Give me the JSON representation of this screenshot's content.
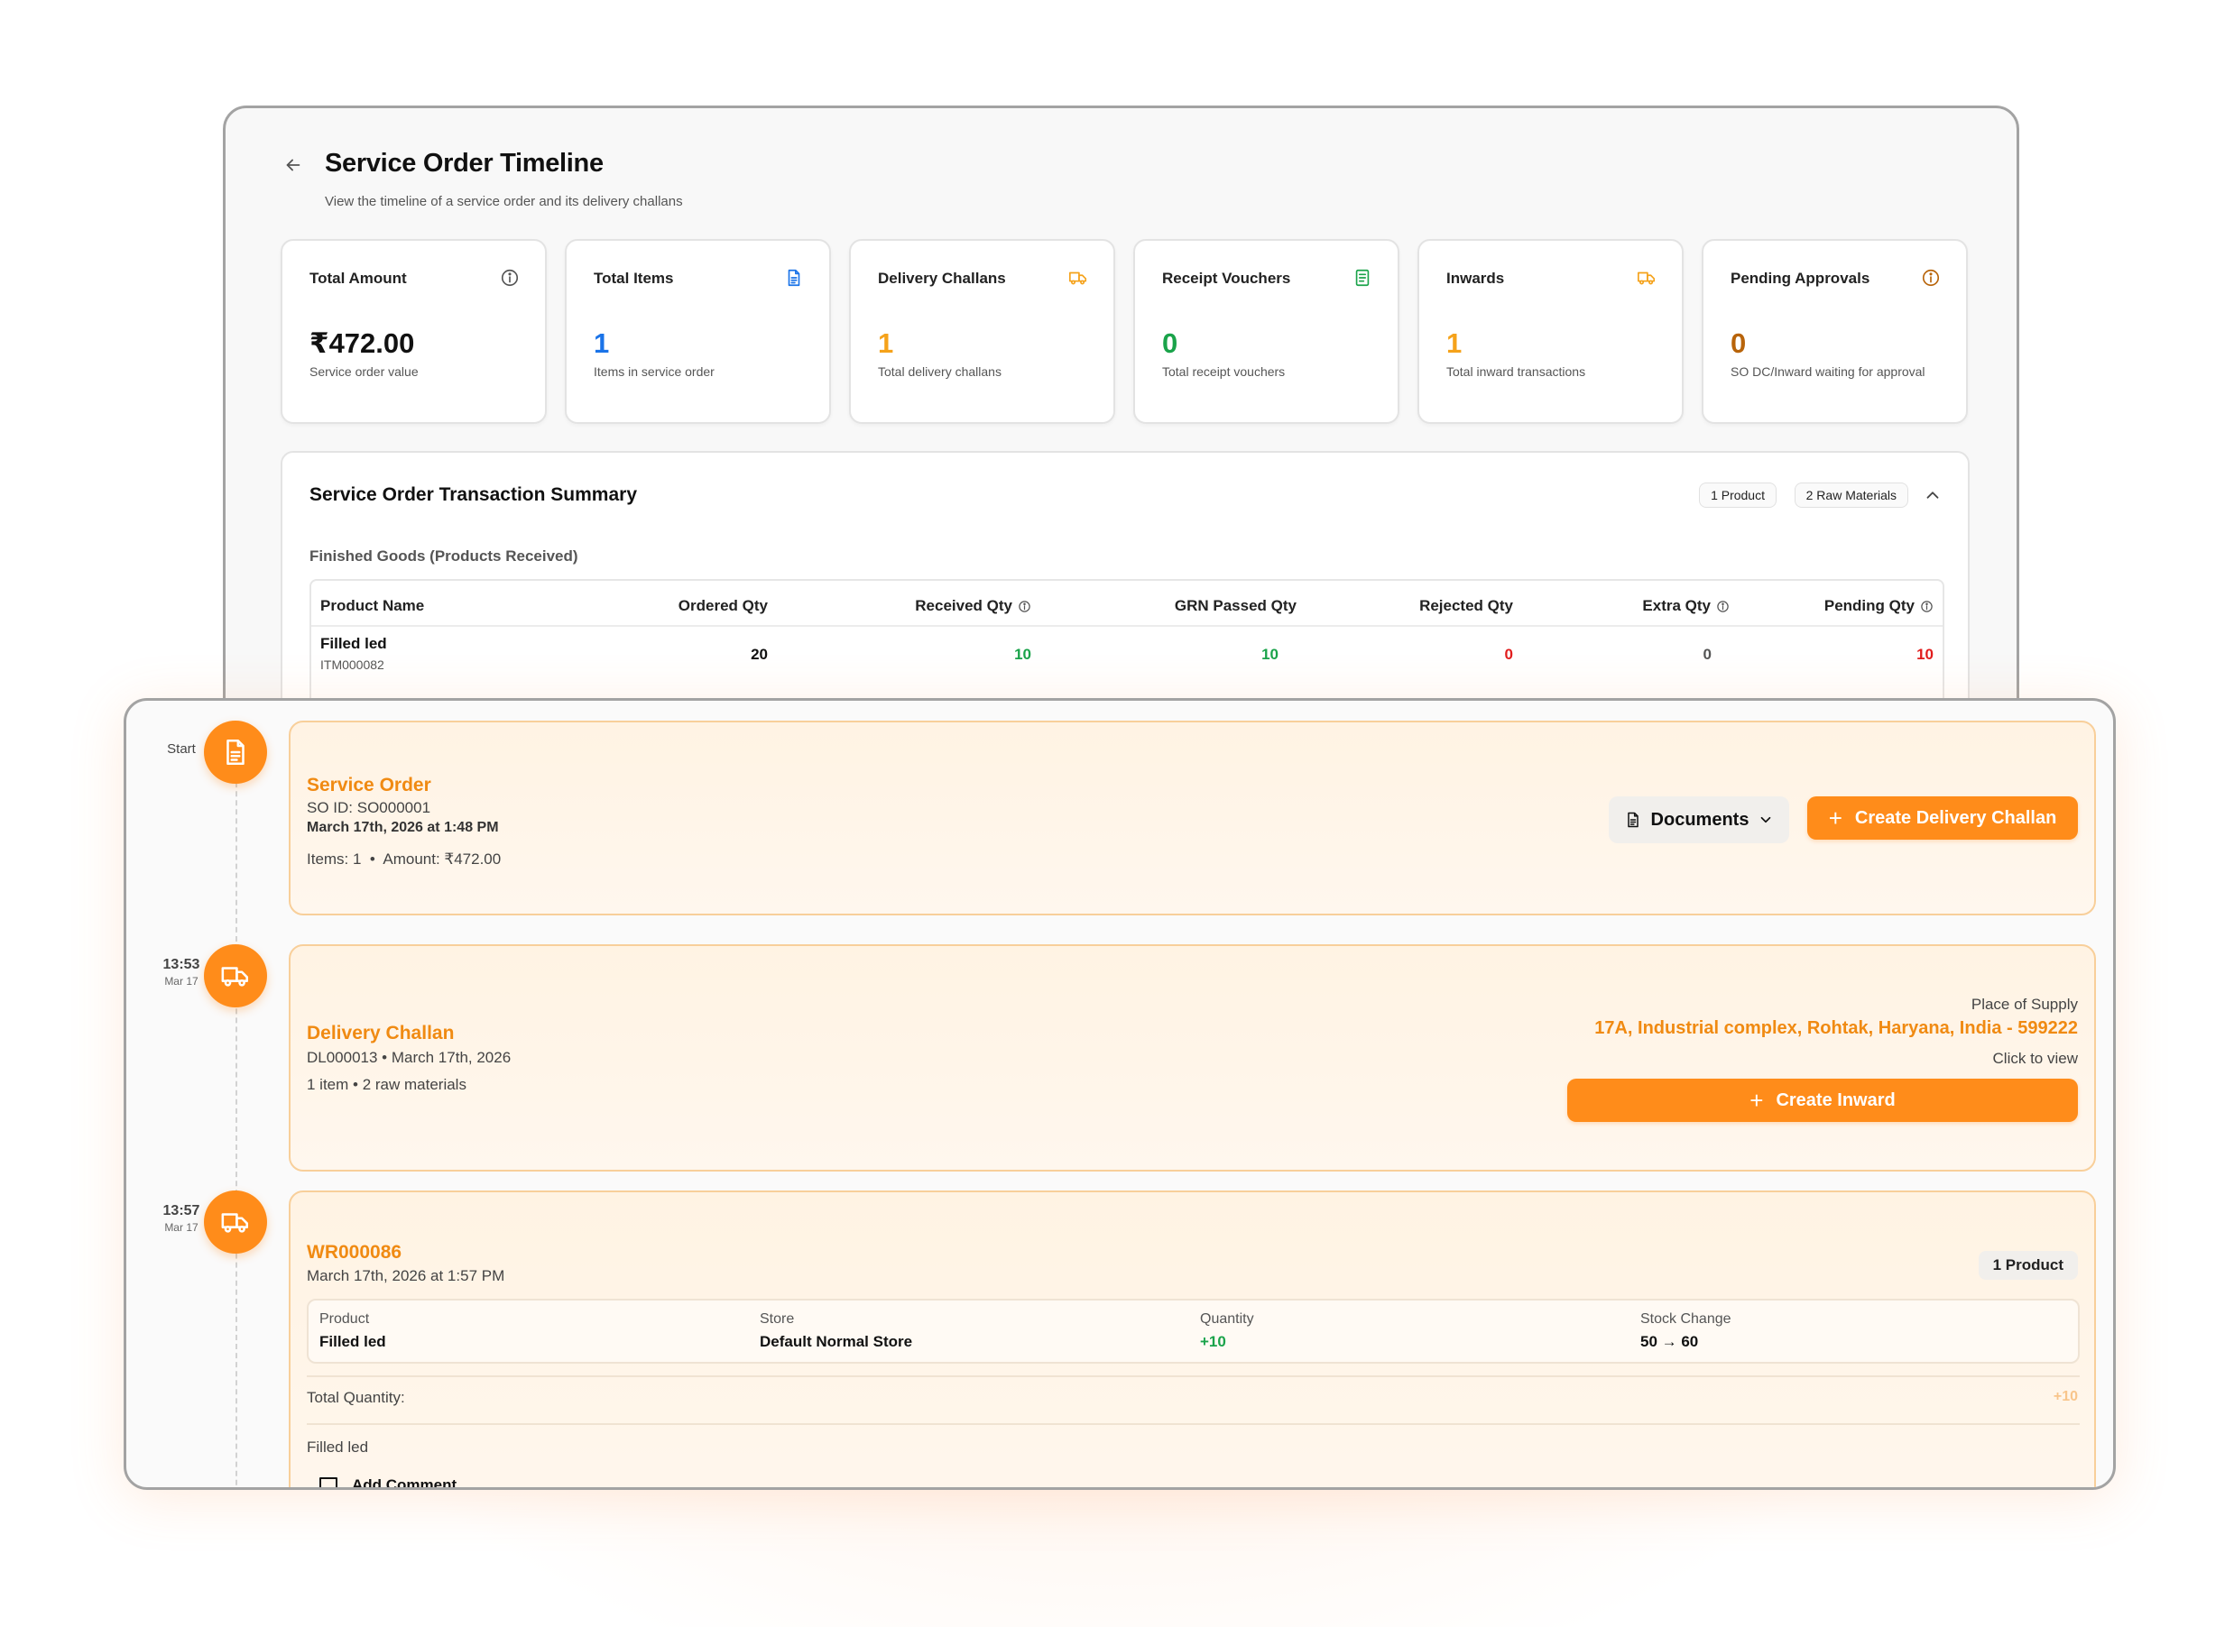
{
  "header": {
    "title": "Service Order Timeline",
    "subtitle": "View the timeline of a service order and its delivery challans"
  },
  "stats": [
    {
      "label": "Total Amount",
      "value": "₹472.00",
      "desc": "Service order value",
      "icon": "info-icon",
      "color": "#111111"
    },
    {
      "label": "Total Items",
      "value": "1",
      "desc": "Items in service order",
      "icon": "document-icon",
      "color": "#1a73e8"
    },
    {
      "label": "Delivery Challans",
      "value": "1",
      "desc": "Total delivery challans",
      "icon": "truck-icon",
      "color": "#f5a21a"
    },
    {
      "label": "Receipt Vouchers",
      "value": "0",
      "desc": "Total receipt vouchers",
      "icon": "receipt-icon",
      "color": "#1aa34a"
    },
    {
      "label": "Inwards",
      "value": "1",
      "desc": "Total inward transactions",
      "icon": "truck-icon",
      "color": "#f5a21a"
    },
    {
      "label": "Pending Approvals",
      "value": "0",
      "desc": "SO DC/Inward waiting for approval",
      "icon": "info-icon",
      "color": "#b8640a"
    }
  ],
  "summary": {
    "title": "Service Order Transaction Summary",
    "badges": [
      "1 Product",
      "2 Raw Materials"
    ],
    "section": "Finished Goods (Products Received)",
    "columns": [
      "Product Name",
      "Ordered Qty",
      "Received Qty",
      "GRN Passed Qty",
      "Rejected Qty",
      "Extra Qty",
      "Pending Qty"
    ],
    "rows": [
      {
        "name": "Filled led",
        "code": "ITM000082",
        "ordered": "20",
        "received": "10",
        "grn": "10",
        "rejected": "0",
        "extra": "0",
        "pending": "10"
      }
    ]
  },
  "timeline": {
    "start_label": "Start",
    "events": [
      {
        "time": "",
        "date": "",
        "title": "Service Order",
        "line1": "SO ID: SO000001",
        "line2": "March 17th, 2026 at 1:48 PM",
        "line3": "Items: 1  •  Amount: ₹472.00",
        "documents_label": "Documents",
        "action_label": "Create Delivery Challan"
      },
      {
        "time": "13:53",
        "date": "Mar 17",
        "title": "Delivery Challan",
        "line1": "DL000013 • March 17th, 2026",
        "line2": "1 item • 2 raw materials",
        "place_label": "Place of Supply",
        "place_value": "17A, Industrial complex, Rohtak, Haryana, India - 599222",
        "click_label": "Click to view",
        "action_label": "Create Inward"
      },
      {
        "time": "13:57",
        "date": "Mar 17",
        "title": "WR000086",
        "line1": "March 17th, 2026 at 1:57 PM",
        "badge": "1 Product",
        "table": {
          "product_label": "Product",
          "product": "Filled led",
          "store_label": "Store",
          "store": "Default Normal Store",
          "quantity_label": "Quantity",
          "quantity": "+10",
          "stock_label": "Stock Change",
          "stock": "50 → 60"
        },
        "total_label": "Total Quantity:",
        "total_value": "+10",
        "note": "Filled led",
        "comment_label": "Add Comment"
      }
    ]
  },
  "colors": {
    "accent": "#ff8c1a",
    "accent_text": "#f08a12",
    "green": "#1aa34a",
    "red": "#e11d1d"
  }
}
